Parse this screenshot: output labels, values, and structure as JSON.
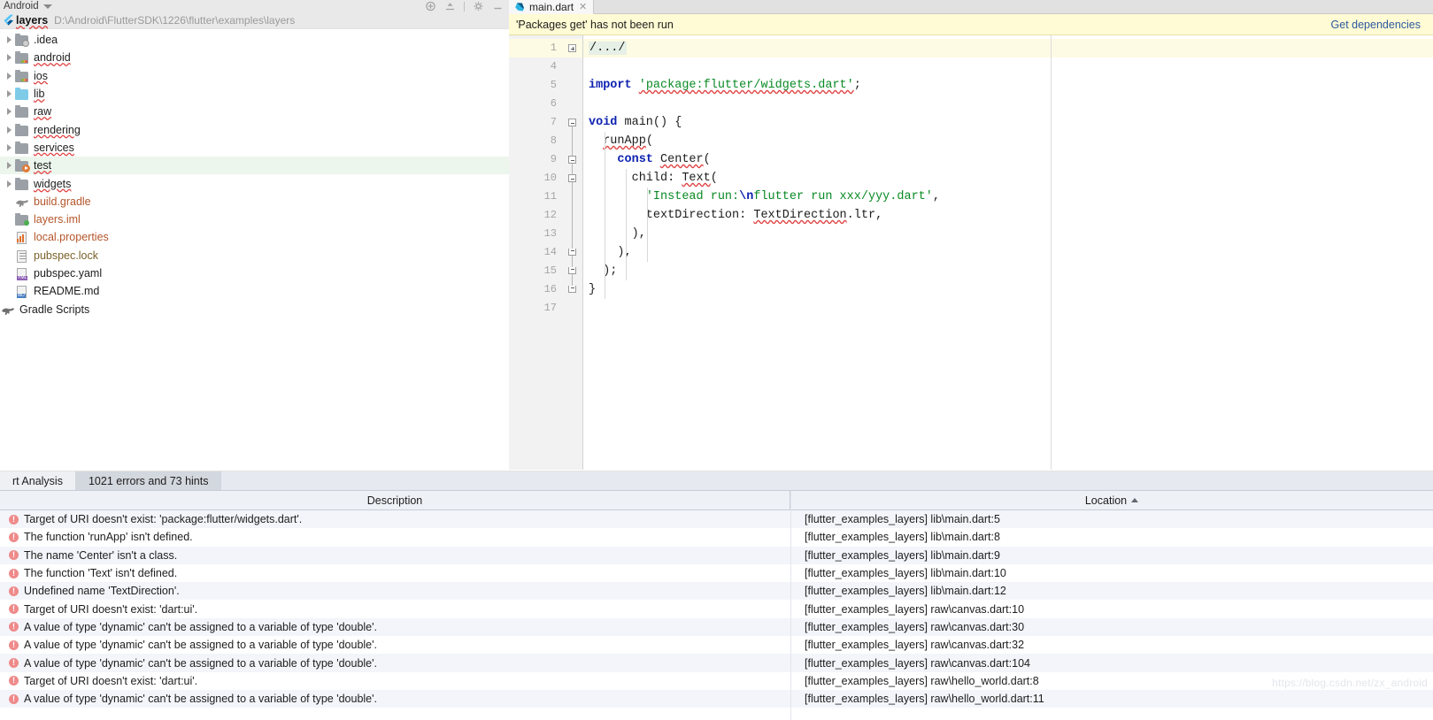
{
  "tool_window": {
    "title": "Android",
    "caret_icon": "chevron-down-icon",
    "actions": [
      "target-icon",
      "collapse-all-icon",
      "settings-gear-icon",
      "hide-icon"
    ]
  },
  "project": {
    "name": "layers",
    "path": "D:\\Android\\FlutterSDK\\1226\\flutter\\examples\\layers",
    "logo_icon": "flutter-logo-icon",
    "tree": [
      {
        "label": ".idea",
        "icon": "folder-idea-icon",
        "expandable": true,
        "selected": false,
        "style": "plain"
      },
      {
        "label": "android",
        "icon": "folder-module-icon",
        "expandable": true,
        "selected": false,
        "style": "wavy"
      },
      {
        "label": "ios",
        "icon": "folder-module-icon",
        "expandable": true,
        "selected": false,
        "style": "wavy"
      },
      {
        "label": "lib",
        "icon": "folder-source-icon",
        "expandable": true,
        "selected": false,
        "style": "wavy"
      },
      {
        "label": "raw",
        "icon": "folder-icon",
        "expandable": true,
        "selected": false,
        "style": "wavy"
      },
      {
        "label": "rendering",
        "icon": "folder-icon",
        "expandable": true,
        "selected": false,
        "style": "wavy"
      },
      {
        "label": "services",
        "icon": "folder-icon",
        "expandable": true,
        "selected": false,
        "style": "wavy"
      },
      {
        "label": "test",
        "icon": "folder-test-icon",
        "expandable": true,
        "selected": true,
        "style": "wavy"
      },
      {
        "label": "widgets",
        "icon": "folder-icon",
        "expandable": true,
        "selected": false,
        "style": "wavy"
      },
      {
        "label": "build.gradle",
        "icon": "gradle-file-icon",
        "expandable": false,
        "selected": false,
        "style": "orange"
      },
      {
        "label": "layers.iml",
        "icon": "iml-file-icon",
        "expandable": false,
        "selected": false,
        "style": "orange"
      },
      {
        "label": "local.properties",
        "icon": "properties-file-icon",
        "expandable": false,
        "selected": false,
        "style": "orange"
      },
      {
        "label": "pubspec.lock",
        "icon": "lock-file-icon",
        "expandable": false,
        "selected": false,
        "style": "brown"
      },
      {
        "label": "pubspec.yaml",
        "icon": "yaml-file-icon",
        "expandable": false,
        "selected": false,
        "style": "plain"
      },
      {
        "label": "README.md",
        "icon": "markdown-file-icon",
        "expandable": false,
        "selected": false,
        "style": "plain"
      },
      {
        "label": "Gradle Scripts",
        "icon": "gradle-icon",
        "expandable": false,
        "selected": false,
        "style": "plain",
        "root": true
      }
    ]
  },
  "editor": {
    "tabs": [
      {
        "label": "main.dart",
        "icon": "dart-file-icon",
        "active": true,
        "close_icon": "close-icon"
      }
    ],
    "notification": {
      "message": "'Packages get' has not been run",
      "action_label": "Get dependencies"
    },
    "lines": [
      {
        "num": "1",
        "text": "/.../",
        "kind": "folded"
      },
      {
        "num": "4",
        "text": "",
        "kind": "blank"
      },
      {
        "num": "5",
        "text": "import 'package:flutter/widgets.dart';",
        "kind": "import"
      },
      {
        "num": "6",
        "text": "",
        "kind": "blank"
      },
      {
        "num": "7",
        "text": "void main() {",
        "kind": "code"
      },
      {
        "num": "8",
        "text": "  runApp(",
        "kind": "code"
      },
      {
        "num": "9",
        "text": "    const Center(",
        "kind": "code"
      },
      {
        "num": "10",
        "text": "      child: Text(",
        "kind": "code"
      },
      {
        "num": "11",
        "text": "        'Instead run:\\nflutter run xxx/yyy.dart',",
        "kind": "code"
      },
      {
        "num": "12",
        "text": "        textDirection: TextDirection.ltr,",
        "kind": "code"
      },
      {
        "num": "13",
        "text": "      ),",
        "kind": "code"
      },
      {
        "num": "14",
        "text": "    ),",
        "kind": "code"
      },
      {
        "num": "15",
        "text": "  );",
        "kind": "code"
      },
      {
        "num": "16",
        "text": "}",
        "kind": "code"
      },
      {
        "num": "17",
        "text": "",
        "kind": "blank"
      }
    ]
  },
  "analysis": {
    "tabs": [
      {
        "label": "rt Analysis",
        "active": false
      },
      {
        "label": "1021 errors and 73 hints",
        "active": true
      }
    ],
    "columns": {
      "description": "Description",
      "location": "Location",
      "sort_icon": "sort-ascending-icon"
    },
    "rows": [
      {
        "severity_icon": "error-icon",
        "description": "Target of URI doesn't exist: 'package:flutter/widgets.dart'.",
        "location": "[flutter_examples_layers] lib\\main.dart:5"
      },
      {
        "severity_icon": "error-icon",
        "description": "The function 'runApp' isn't defined.",
        "location": "[flutter_examples_layers] lib\\main.dart:8"
      },
      {
        "severity_icon": "error-icon",
        "description": "The name 'Center' isn't a class.",
        "location": "[flutter_examples_layers] lib\\main.dart:9"
      },
      {
        "severity_icon": "error-icon",
        "description": "The function 'Text' isn't defined.",
        "location": "[flutter_examples_layers] lib\\main.dart:10"
      },
      {
        "severity_icon": "error-icon",
        "description": "Undefined name 'TextDirection'.",
        "location": "[flutter_examples_layers] lib\\main.dart:12"
      },
      {
        "severity_icon": "error-icon",
        "description": "Target of URI doesn't exist: 'dart:ui'.",
        "location": "[flutter_examples_layers] raw\\canvas.dart:10"
      },
      {
        "severity_icon": "error-icon",
        "description": "A value of type 'dynamic' can't be assigned to a variable of type 'double'.",
        "location": "[flutter_examples_layers] raw\\canvas.dart:30"
      },
      {
        "severity_icon": "error-icon",
        "description": "A value of type 'dynamic' can't be assigned to a variable of type 'double'.",
        "location": "[flutter_examples_layers] raw\\canvas.dart:32"
      },
      {
        "severity_icon": "error-icon",
        "description": "A value of type 'dynamic' can't be assigned to a variable of type 'double'.",
        "location": "[flutter_examples_layers] raw\\canvas.dart:104"
      },
      {
        "severity_icon": "error-icon",
        "description": "Target of URI doesn't exist: 'dart:ui'.",
        "location": "[flutter_examples_layers] raw\\hello_world.dart:8"
      },
      {
        "severity_icon": "error-icon",
        "description": "A value of type 'dynamic' can't be assigned to a variable of type 'double'.",
        "location": "[flutter_examples_layers] raw\\hello_world.dart:11"
      }
    ]
  },
  "watermark": "https://blog.csdn.net/zx_android",
  "colors": {
    "accent_link": "#2c5aa0",
    "notification_bg": "#fffbd4",
    "error": "#ef8a8a",
    "selection": "#edf6ed",
    "keyword": "#0d22b0",
    "string": "#0a8a24"
  }
}
